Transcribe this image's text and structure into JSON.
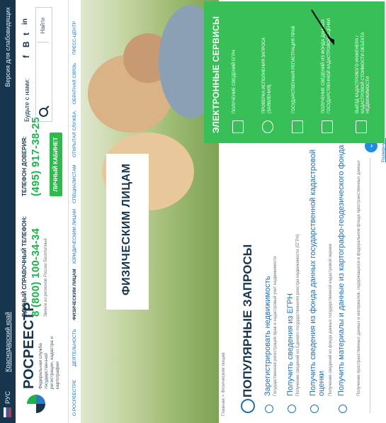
{
  "topbar": {
    "lang": "РУС",
    "region": "Краснодарский край",
    "vision": "Версия для слабовидящих"
  },
  "header": {
    "brand": "РОСРЕЕСТР",
    "brand_sub": "Федеральная служба государственной регистрации, кадастра и картографии",
    "phone1_label": "ЕДИНЫЙ СПРАВОЧНЫЙ ТЕЛЕФОН:",
    "phone1_number": "8 (800) 100-34-34",
    "phone1_note": "Звонок из регионов России бесплатный",
    "phone2_label": "ТЕЛЕФОН ДОВЕРИЯ:",
    "phone2_number": "(495) 917-38-25",
    "cabinet": "ЛИЧНЫЙ КАБИНЕТ",
    "social_label": "Будьте с нами:",
    "social": [
      "f",
      "B",
      "t",
      "in"
    ],
    "search_button": "Найти"
  },
  "nav": [
    "О РОСРЕЕСТРЕ",
    "ДЕЯТЕЛЬНОСТЬ",
    "ФИЗИЧЕСКИМ ЛИЦАМ",
    "ЮРИДИЧЕСКИМ ЛИЦАМ",
    "СПЕЦИАЛИСТАМ",
    "ОТКРЫТАЯ СЛУЖБА",
    "ОБРАТНАЯ СВЯЗЬ",
    "ПРЕСС-ЦЕНТР"
  ],
  "hero": {
    "title": "ФИЗИЧЕСКИМ ЛИЦАМ"
  },
  "breadcrumb": "Главная > Физическим лицам",
  "requests": {
    "title": "ПОПУЛЯРНЫЕ ЗАПРОСЫ",
    "items": [
      {
        "title": "Зарегистрировать недвижимость",
        "desc": "Государственная регистрация прав и кадастровый учет недвижимости"
      },
      {
        "title": "Получить сведения из ЕГРН",
        "desc": "Получение сведений из Единого государственного реестра недвижимости (ЕГРН)"
      },
      {
        "title": "Получить сведения из фонда данных государственной кадастровой оценки",
        "desc": "Получение сведений из фонда данных государственной кадастровой оценки"
      },
      {
        "title": "Получить материалы и данные из картографо-геодезического фонда",
        "desc": "Получение пространственных данных и материалов, содержащихся в федеральном фонде пространственных данных"
      }
    ],
    "more": "Развернуть"
  },
  "eservices": {
    "title": "ЭЛЕКТРОННЫЕ СЕРВИСЫ",
    "items": [
      "ПОЛУЧЕНИЕ СВЕДЕНИЙ ЕГРН",
      "ПРОВЕРКА ИСПОЛНЕНИЯ ЗАПРОСА (ЗАЯВЛЕНИЯ)",
      "ГОСУДАРСТВЕННАЯ РЕГИСТРАЦИЯ ПРАВ",
      "ПОЛУЧЕНИЕ СВЕДЕНИЙ ИЗ ФОНДА ДАННЫХ ГОСУДАРСТВЕННОЙ КАДАСТРОВОЙ ОЦЕНКИ",
      "ВЫЕЗД КАДАСТРОВОГО ИНЖЕНЕРА / КАДАСТРОВОЙ СТОИМОСТИ ОБЪЕКТА НЕДВИЖИМОСТИ"
    ]
  }
}
